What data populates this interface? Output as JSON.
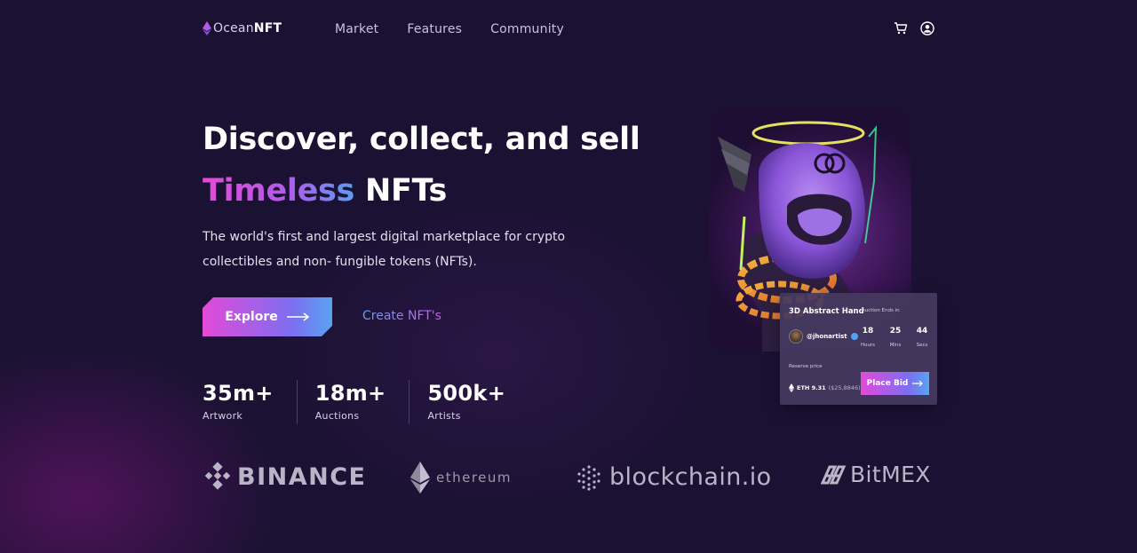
{
  "brand": {
    "name_part1": "Ocean",
    "name_part2": "NFT"
  },
  "nav": {
    "items": [
      {
        "label": "Market"
      },
      {
        "label": "Features"
      },
      {
        "label": "Community"
      }
    ],
    "icons": [
      "cart-icon",
      "user-icon"
    ]
  },
  "hero": {
    "title_line1": "Discover, collect, and sell",
    "title_highlight": "Timeless",
    "title_rest": " NFTs",
    "subtitle": "The world's first and largest digital marketplace for crypto collectibles and non- fungible tokens (NFTs).",
    "explore_label": "Explore",
    "create_label": "Create NFT's"
  },
  "stats": [
    {
      "value": "35m+",
      "label": "Artwork"
    },
    {
      "value": "18m+",
      "label": "Auctions"
    },
    {
      "value": "500k+",
      "label": "Artists"
    }
  ],
  "partners": {
    "binance": "BINANCE",
    "ethereum": "ethereum",
    "blockchain": "blockchain.io",
    "bitmex": "BitMEX"
  },
  "auction": {
    "title": "3D Abstract Hand",
    "ends_label": "Auction Ends in",
    "artist": "@jhonartist",
    "countdown": [
      {
        "value": "18",
        "unit": "Hours"
      },
      {
        "value": "25",
        "unit": "Mins"
      },
      {
        "value": "44",
        "unit": "Secs"
      }
    ],
    "reserve_label": "Reserve price",
    "price_eth": "ETH 9.31",
    "price_usd": "($25,8846)",
    "bid_label": "Place Bid"
  },
  "colors": {
    "background": "#1b1233",
    "accent_pink": "#e24ad8",
    "accent_blue": "#58a4f2"
  }
}
